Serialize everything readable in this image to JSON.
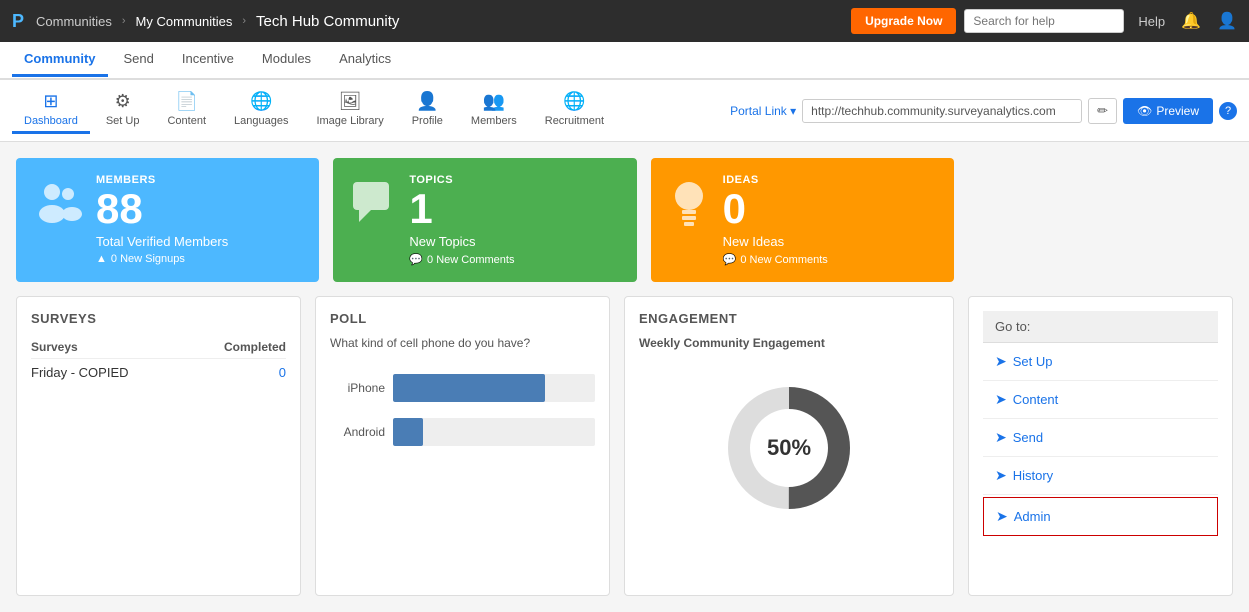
{
  "topnav": {
    "brand": "P",
    "communities_link": "Communities",
    "my_communities_link": "My Communities",
    "page_title": "Tech Hub Community",
    "upgrade_btn": "Upgrade Now",
    "search_placeholder": "Search for help",
    "help_label": "Help"
  },
  "secondnav": {
    "tabs": [
      {
        "label": "Community",
        "active": true
      },
      {
        "label": "Send",
        "active": false
      },
      {
        "label": "Incentive",
        "active": false
      },
      {
        "label": "Modules",
        "active": false
      },
      {
        "label": "Analytics",
        "active": false
      }
    ]
  },
  "toolbar": {
    "items": [
      {
        "label": "Dashboard",
        "icon": "⊞",
        "active": true
      },
      {
        "label": "Set Up",
        "icon": "⚙",
        "active": false
      },
      {
        "label": "Content",
        "icon": "📄",
        "active": false
      },
      {
        "label": "Languages",
        "icon": "🌐",
        "active": false
      },
      {
        "label": "Image Library",
        "icon": "🖼",
        "active": false
      },
      {
        "label": "Profile",
        "icon": "👤",
        "active": false
      },
      {
        "label": "Members",
        "icon": "👥",
        "active": false
      },
      {
        "label": "Recruitment",
        "icon": "🌐",
        "active": false
      }
    ],
    "portal_link_label": "Portal Link ▾",
    "portal_link_url": "http://techhub.community.surveyanalytics.com",
    "preview_btn": "Preview"
  },
  "stats": {
    "members": {
      "label": "MEMBERS",
      "count": "88",
      "desc": "Total Verified Members",
      "sub": "0 New Signups"
    },
    "topics": {
      "label": "TOPICS",
      "count": "1",
      "desc": "New Topics",
      "sub": "0 New Comments"
    },
    "ideas": {
      "label": "IDEAS",
      "count": "0",
      "desc": "New Ideas",
      "sub": "0 New Comments"
    }
  },
  "surveys": {
    "title": "SURVEYS",
    "col_survey": "Surveys",
    "col_completed": "Completed",
    "rows": [
      {
        "name": "Friday - COPIED",
        "completed": "0"
      }
    ]
  },
  "poll": {
    "title": "POLL",
    "question": "What kind of cell phone do you have?",
    "bars": [
      {
        "label": "iPhone",
        "pct": 75
      },
      {
        "label": "Android",
        "pct": 15
      }
    ]
  },
  "engagement": {
    "title": "ENGAGEMENT",
    "subtitle": "Weekly Community Engagement",
    "pct": 50,
    "pct_label": "50%"
  },
  "goto": {
    "title": "Go to:",
    "items": [
      {
        "label": "Set Up",
        "icon": "➤"
      },
      {
        "label": "Content",
        "icon": "➤"
      },
      {
        "label": "Send",
        "icon": "➤"
      },
      {
        "label": "History",
        "icon": "➤"
      },
      {
        "label": "Admin",
        "icon": "➤",
        "admin": true
      }
    ]
  }
}
